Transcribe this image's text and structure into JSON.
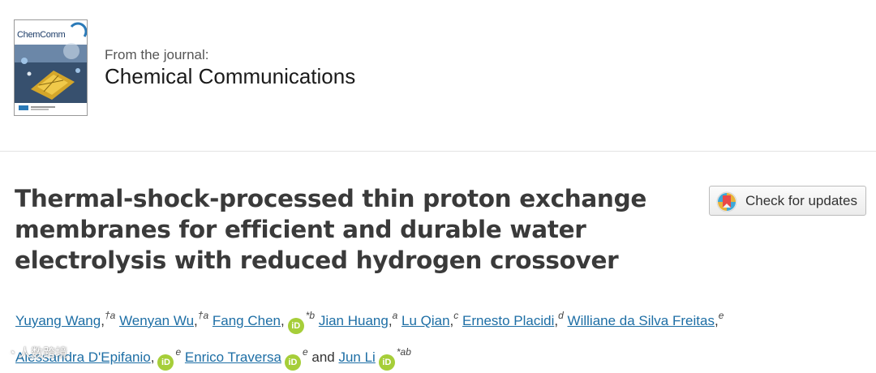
{
  "journal": {
    "cover_title": "ChemComm",
    "from_label": "From the journal:",
    "name": "Chemical Communications"
  },
  "article": {
    "title": "Thermal-shock-processed thin proton exchange membranes for efficient and durable water electrolysis with reduced hydrogen crossover",
    "update_button_label": "Check for updates"
  },
  "authors": [
    {
      "name": "Yuyang Wang",
      "sup": "†a",
      "orcid": false
    },
    {
      "name": "Wenyan Wu",
      "sup": "†a",
      "orcid": false
    },
    {
      "name": "Fang Chen",
      "sup": "*b",
      "orcid": true
    },
    {
      "name": "Jian Huang",
      "sup": "a",
      "orcid": false
    },
    {
      "name": "Lu Qian",
      "sup": "c",
      "orcid": false
    },
    {
      "name": "Ernesto Placidi",
      "sup": "d",
      "orcid": false
    },
    {
      "name": "Williane da Silva Freitas",
      "sup": "e",
      "orcid": false
    },
    {
      "name": "Alessandra D'Epifanio",
      "sup": "e",
      "orcid": true
    },
    {
      "name": "Enrico Traversa",
      "sup": "e",
      "orcid": true
    },
    {
      "name": "Jun Li",
      "sup": "*ab",
      "orcid": true
    }
  ],
  "separators": {
    "comma": ",",
    "and": "and"
  },
  "orcid_label": "iD",
  "watermark": "人数跨境",
  "colors": {
    "link": "#1d6ea5",
    "orcid": "#a6ce39",
    "title": "#3a3a3a"
  }
}
